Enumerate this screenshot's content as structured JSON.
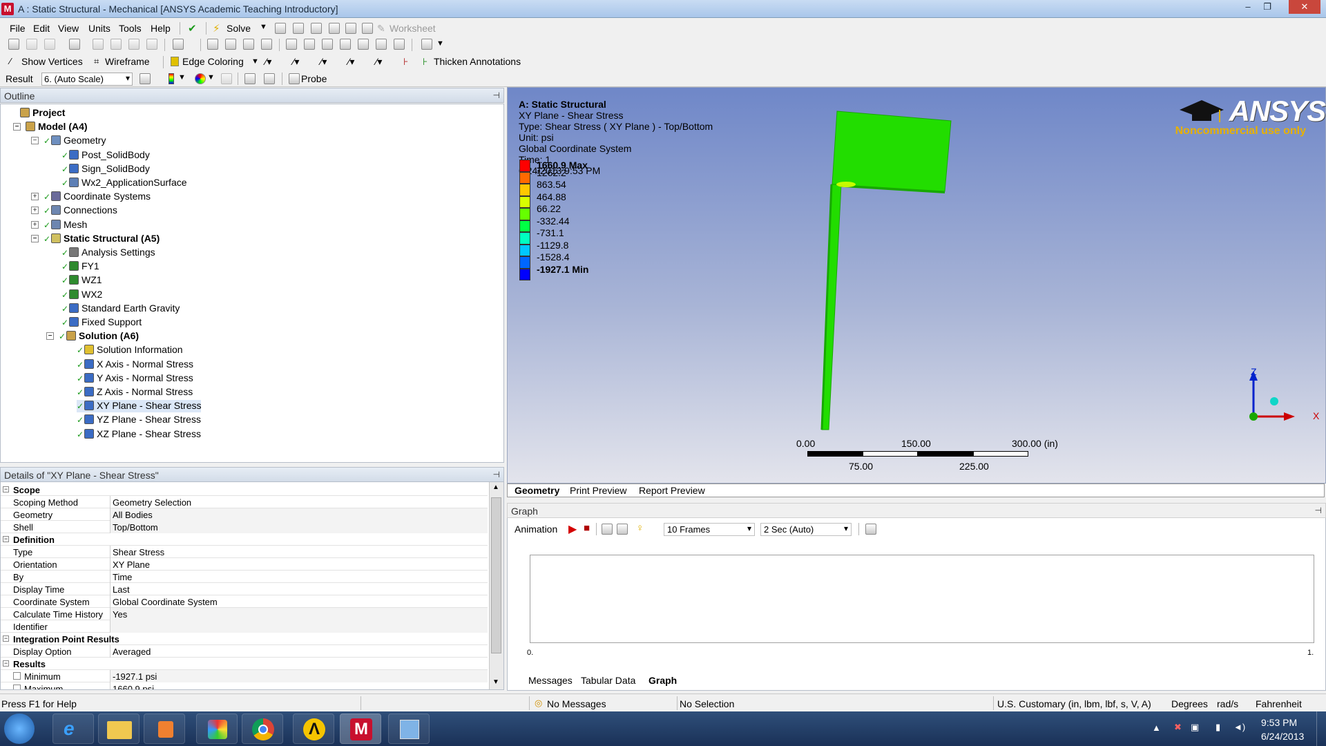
{
  "window": {
    "title": "A : Static Structural - Mechanical [ANSYS Academic Teaching Introductory]",
    "app_icon_letter": "M",
    "min": "–",
    "restore": "❐",
    "close": "✕"
  },
  "menu": {
    "items": [
      "File",
      "Edit",
      "View",
      "Units",
      "Tools",
      "Help"
    ],
    "solve": "Solve",
    "worksheet": "Worksheet"
  },
  "toolbar2": {
    "show_vertices": "Show Vertices",
    "wireframe": "Wireframe",
    "edge_coloring": "Edge Coloring",
    "thicken_annotations": "Thicken Annotations"
  },
  "toolbar3": {
    "result_label": "Result",
    "result_scale": "6. (Auto Scale)",
    "probe": "Probe"
  },
  "outline": {
    "header": "Outline",
    "tree": [
      {
        "label": "Project",
        "bold": true
      },
      {
        "label": "Model (A4)",
        "bold": true
      },
      {
        "label": "Geometry",
        "bold": false
      },
      {
        "label": "Post_SolidBody",
        "bold": false
      },
      {
        "label": "Sign_SolidBody",
        "bold": false
      },
      {
        "label": "Wx2_ApplicationSurface",
        "bold": false
      },
      {
        "label": "Coordinate Systems",
        "bold": false
      },
      {
        "label": "Connections",
        "bold": false
      },
      {
        "label": "Mesh",
        "bold": false
      },
      {
        "label": "Static Structural (A5)",
        "bold": true
      },
      {
        "label": "Analysis Settings",
        "bold": false
      },
      {
        "label": "FY1",
        "bold": false
      },
      {
        "label": "WZ1",
        "bold": false
      },
      {
        "label": "WX2",
        "bold": false
      },
      {
        "label": "Standard Earth Gravity",
        "bold": false
      },
      {
        "label": "Fixed Support",
        "bold": false
      },
      {
        "label": "Solution (A6)",
        "bold": true
      },
      {
        "label": "Solution Information",
        "bold": false
      },
      {
        "label": "X Axis - Normal Stress",
        "bold": false
      },
      {
        "label": "Y Axis - Normal Stress",
        "bold": false
      },
      {
        "label": "Z Axis - Normal Stress",
        "bold": false
      },
      {
        "label": "XY Plane - Shear Stress",
        "bold": false
      },
      {
        "label": "YZ Plane - Shear Stress",
        "bold": false
      },
      {
        "label": "XZ Plane - Shear Stress",
        "bold": false
      }
    ]
  },
  "details": {
    "header": "Details of \"XY Plane - Shear Stress\"",
    "groups": [
      {
        "name": "Scope",
        "rows": [
          {
            "key": "Scoping Method",
            "value": "Geometry Selection"
          },
          {
            "key": "Geometry",
            "value": "All Bodies"
          },
          {
            "key": "Shell",
            "value": "Top/Bottom"
          }
        ]
      },
      {
        "name": "Definition",
        "rows": [
          {
            "key": "Type",
            "value": "Shear Stress"
          },
          {
            "key": "Orientation",
            "value": "XY Plane"
          },
          {
            "key": "By",
            "value": "Time"
          },
          {
            "key": "Display Time",
            "value": "Last"
          },
          {
            "key": "Coordinate System",
            "value": "Global Coordinate System"
          },
          {
            "key": "Calculate Time History",
            "value": "Yes"
          },
          {
            "key": "Identifier",
            "value": ""
          }
        ]
      },
      {
        "name": "Integration Point Results",
        "rows": [
          {
            "key": "Display Option",
            "value": "Averaged"
          }
        ]
      },
      {
        "name": "Results",
        "rows": [
          {
            "key": "Minimum",
            "value": "-1927.1 psi"
          },
          {
            "key": "Maximum",
            "value": "1660.9 psi"
          }
        ]
      }
    ]
  },
  "viewport": {
    "info": {
      "title": "A: Static Structural",
      "lines": [
        "XY Plane - Shear Stress",
        "Type: Shear Stress ( XY Plane ) - Top/Bottom",
        "Unit: psi",
        "Global Coordinate System",
        "Time: 1",
        "6/24/2013 9:53 PM"
      ]
    },
    "legend": [
      {
        "label": "1660.9 Max",
        "color": "#ff0000"
      },
      {
        "label": "1262.2",
        "color": "#ff6a00"
      },
      {
        "label": "863.54",
        "color": "#ffc800"
      },
      {
        "label": "464.88",
        "color": "#d8ff00"
      },
      {
        "label": "66.22",
        "color": "#66ff00"
      },
      {
        "label": "-332.44",
        "color": "#00ff44"
      },
      {
        "label": "-731.1",
        "color": "#00ffc0"
      },
      {
        "label": "-1129.8",
        "color": "#00c8ff"
      },
      {
        "label": "-1528.4",
        "color": "#0066ff"
      },
      {
        "label": "-1927.1 Min",
        "color": "#0000ff"
      }
    ],
    "logo": {
      "text": "ANSYS",
      "subtitle": "Noncommercial use only"
    },
    "scale": {
      "top": [
        "0.00",
        "150.00",
        "300.00 (in)"
      ],
      "bottom": [
        "75.00",
        "225.00"
      ]
    },
    "triad": {
      "z": "Z",
      "x": "X"
    },
    "model_color": "#22dd00",
    "tabs": [
      "Geometry",
      "Print Preview",
      "Report Preview"
    ]
  },
  "graph": {
    "header": "Graph",
    "animation_label": "Animation",
    "frames": "10 Frames",
    "duration": "2 Sec (Auto)",
    "x_min": "0.",
    "x_max": "1.",
    "tabs": [
      "Messages",
      "Tabular Data",
      "Graph"
    ]
  },
  "status": {
    "help": "Press F1 for Help",
    "messages": "No Messages",
    "selection": "No Selection",
    "units": "U.S. Customary (in, lbm, lbf, s, V, A)",
    "angle": "Degrees",
    "rot": "rad/s",
    "temp": "Fahrenheit"
  },
  "taskbar": {
    "time": "9:53 PM",
    "date": "6/24/2013"
  }
}
